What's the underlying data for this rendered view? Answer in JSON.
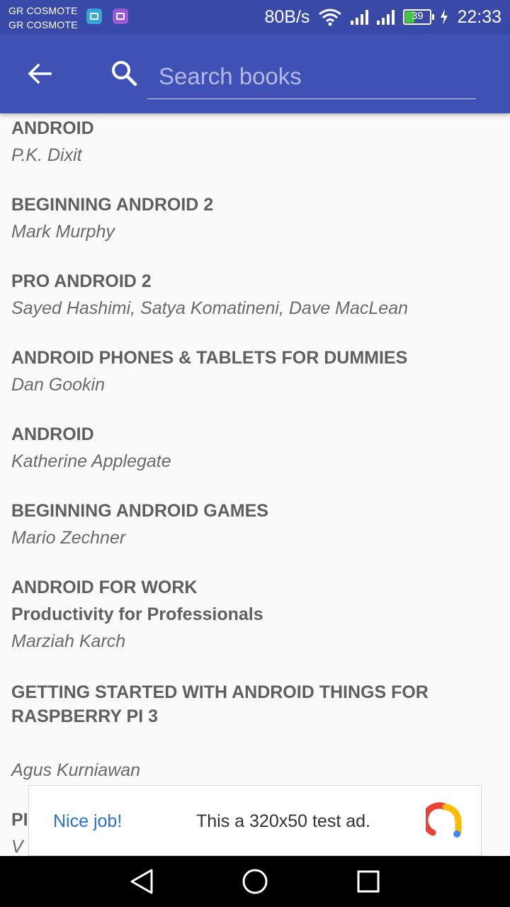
{
  "status_bar": {
    "carrier_1": "GR COSMOTE",
    "carrier_2": "GR COSMOTE",
    "net_speed": "80B/s",
    "battery": "39",
    "time": "22:33"
  },
  "toolbar": {
    "search_placeholder": "Search books",
    "accent_color": "#3f51b5"
  },
  "books": [
    {
      "title": "ANDROID",
      "author": "P.K. Dixit"
    },
    {
      "title": "BEGINNING ANDROID 2",
      "author": "Mark Murphy"
    },
    {
      "title": "PRO ANDROID 2",
      "author": "Sayed Hashimi, Satya Komatineni, Dave MacLean"
    },
    {
      "title": "ANDROID PHONES & TABLETS FOR DUMMIES",
      "author": "Dan Gookin"
    },
    {
      "title": "ANDROID",
      "author": "Katherine Applegate"
    },
    {
      "title": "BEGINNING ANDROID GAMES",
      "author": "Mario Zechner"
    },
    {
      "title": "ANDROID FOR WORK",
      "subtitle": "Productivity for Professionals",
      "author": "Marziah Karch"
    },
    {
      "title": "GETTING STARTED WITH ANDROID THINGS FOR RASPBERRY PI 3",
      "author": "Agus Kurniawan"
    },
    {
      "title": "PI",
      "author": "V"
    }
  ],
  "ad": {
    "left_text": "Nice job!",
    "center_text": "This a 320x50 test ad."
  },
  "icons": [
    "back-arrow-icon",
    "search-icon",
    "wifi-icon",
    "signal-icon",
    "battery-icon",
    "charging-icon",
    "nav-back-icon",
    "nav-home-icon",
    "nav-recents-icon"
  ]
}
